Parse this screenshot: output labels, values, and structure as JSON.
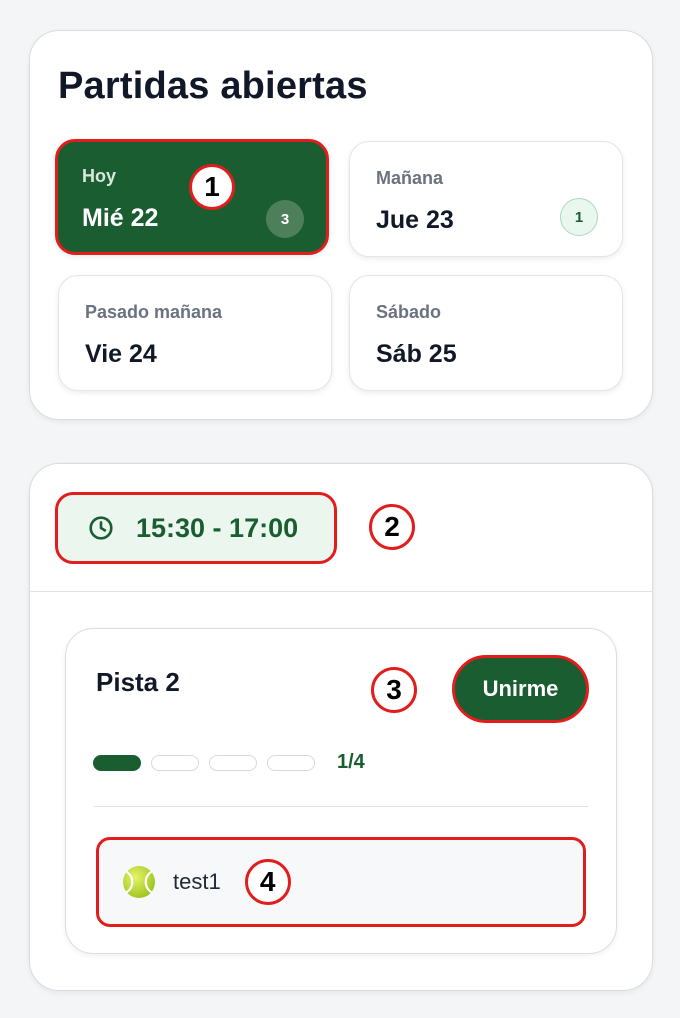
{
  "page": {
    "title": "Partidas abiertas"
  },
  "days": [
    {
      "label": "Hoy",
      "date": "Mié 22",
      "count": "3",
      "active": true
    },
    {
      "label": "Mañana",
      "date": "Jue 23",
      "count": "1",
      "active": false
    },
    {
      "label": "Pasado mañana",
      "date": "Vie 24",
      "active": false
    },
    {
      "label": "Sábado",
      "date": "Sáb 25",
      "active": false
    }
  ],
  "slot": {
    "time": "15:30 - 17:00",
    "icon": "clock-icon"
  },
  "court": {
    "name": "Pista 2",
    "join_label": "Unirme",
    "occupancy_text": "1/4",
    "occupancy": {
      "filled": 1,
      "total": 4
    },
    "players": [
      {
        "name": "test1",
        "icon": "tennis-ball-icon"
      }
    ]
  },
  "markers": [
    "1",
    "2",
    "3",
    "4"
  ],
  "colors": {
    "primary": "#1a5d30",
    "highlight": "#e11d1d",
    "light_green": "#eaf6ee"
  }
}
